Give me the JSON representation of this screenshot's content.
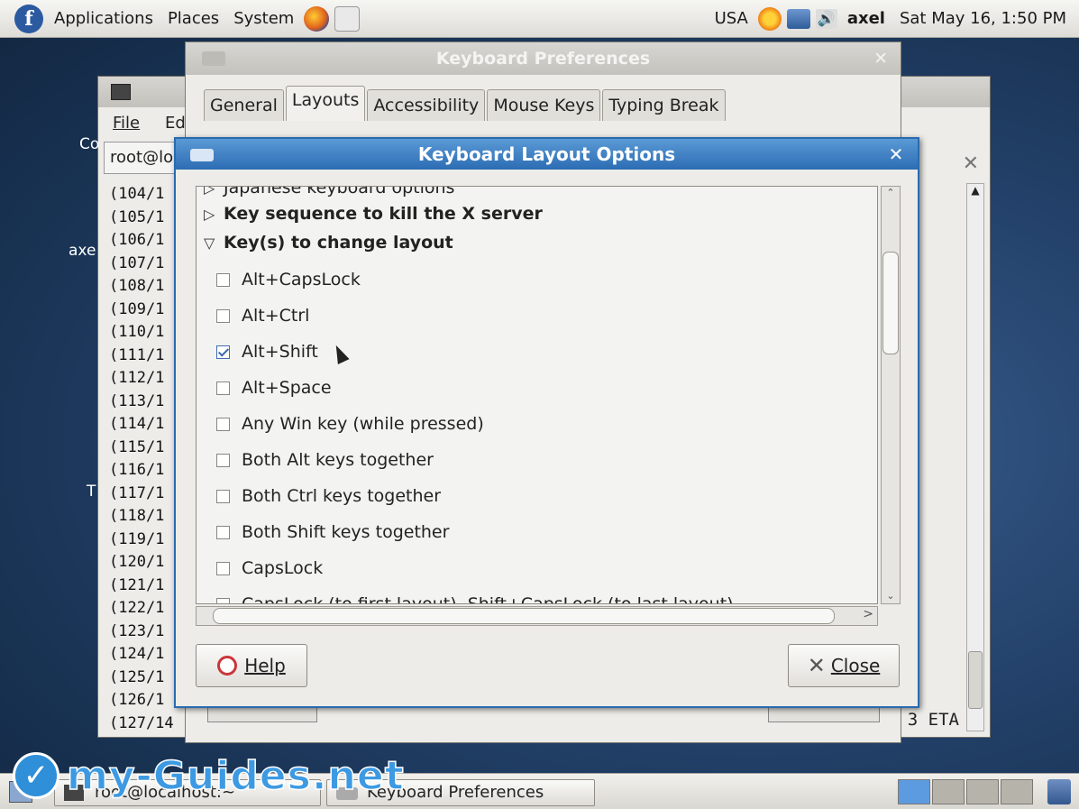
{
  "top_panel": {
    "menus": [
      "Applications",
      "Places",
      "System"
    ],
    "keyboard_layout": "USA",
    "user": "axel",
    "clock": "Sat May 16,  1:50 PM"
  },
  "terminal": {
    "menu_file": "File",
    "menu_edit": "Ed",
    "tab_label": "root@lo",
    "side_text": [
      "Co",
      "axe",
      "T"
    ],
    "lines": [
      "(104/1",
      "(105/1",
      "(106/1",
      "(107/1",
      "(108/1",
      "(109/1",
      "(110/1",
      "(111/1",
      "(112/1",
      "(113/1",
      "(114/1",
      "(115/1",
      "(116/1",
      "(117/1",
      "(118/1",
      "(119/1",
      "(120/1",
      "(121/1",
      "(122/1",
      "(123/1",
      "(124/1",
      "(125/1",
      "(126/1",
      "(127/14"
    ],
    "status_tail": "3  ETA"
  },
  "keyboard_prefs": {
    "title": "Keyboard Preferences",
    "tabs": [
      "General",
      "Layouts",
      "Accessibility",
      "Mouse Keys",
      "Typing Break"
    ],
    "active_tab": "Layouts"
  },
  "dialog": {
    "title": "Keyboard Layout Options",
    "groups": [
      {
        "label": "Japanese keyboard options",
        "expanded": false
      },
      {
        "label": "Key sequence to kill the X server",
        "expanded": false
      },
      {
        "label": "Key(s) to change layout",
        "expanded": true
      }
    ],
    "options": [
      {
        "label": "Alt+CapsLock",
        "checked": false
      },
      {
        "label": "Alt+Ctrl",
        "checked": false
      },
      {
        "label": "Alt+Shift",
        "checked": true
      },
      {
        "label": "Alt+Space",
        "checked": false
      },
      {
        "label": "Any Win key (while pressed)",
        "checked": false
      },
      {
        "label": "Both Alt keys together",
        "checked": false
      },
      {
        "label": "Both Ctrl keys together",
        "checked": false
      },
      {
        "label": "Both Shift keys together",
        "checked": false
      },
      {
        "label": "CapsLock",
        "checked": false
      },
      {
        "label": "CapsLock (to first layout), Shift+CapsLock (to last layout)",
        "checked": false
      }
    ],
    "help_label": "Help",
    "close_label": "Close"
  },
  "bottom_panel": {
    "tasks": [
      "root@localhost:~",
      "Keyboard Preferences"
    ]
  },
  "watermark": "my-Guides.net"
}
